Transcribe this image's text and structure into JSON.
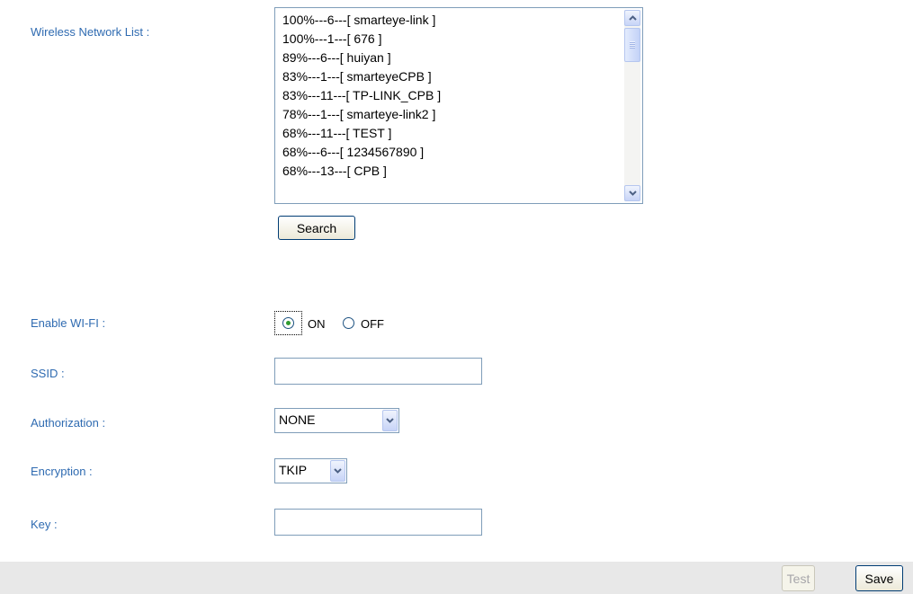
{
  "labels": {
    "wireless_list": "Wireless Network List :",
    "enable_wifi": "Enable WI-FI :",
    "ssid": "SSID :",
    "authorization": "Authorization :",
    "encryption": "Encryption :",
    "key": "Key :"
  },
  "networks": [
    "100%---6---[ smarteye-link ]",
    "100%---1---[ 676 ]",
    "89%---6---[ huiyan ]",
    "83%---1---[ smarteyeCPB ]",
    "83%---11---[ TP-LINK_CPB ]",
    "78%---1---[ smarteye-link2 ]",
    "68%---11---[ TEST ]",
    "68%---6---[ 1234567890 ]",
    "68%---13---[ CPB ]"
  ],
  "buttons": {
    "search": "Search",
    "test": "Test",
    "save": "Save"
  },
  "wifi": {
    "on_label": "ON",
    "off_label": "OFF",
    "selected": "ON"
  },
  "fields": {
    "ssid_value": "",
    "key_value": ""
  },
  "selects": {
    "authorization": "NONE",
    "encryption": "TKIP"
  },
  "icons": {
    "scroll_up": "chevron-up-icon",
    "scroll_down": "chevron-down-icon",
    "dropdown": "chevron-down-icon"
  }
}
